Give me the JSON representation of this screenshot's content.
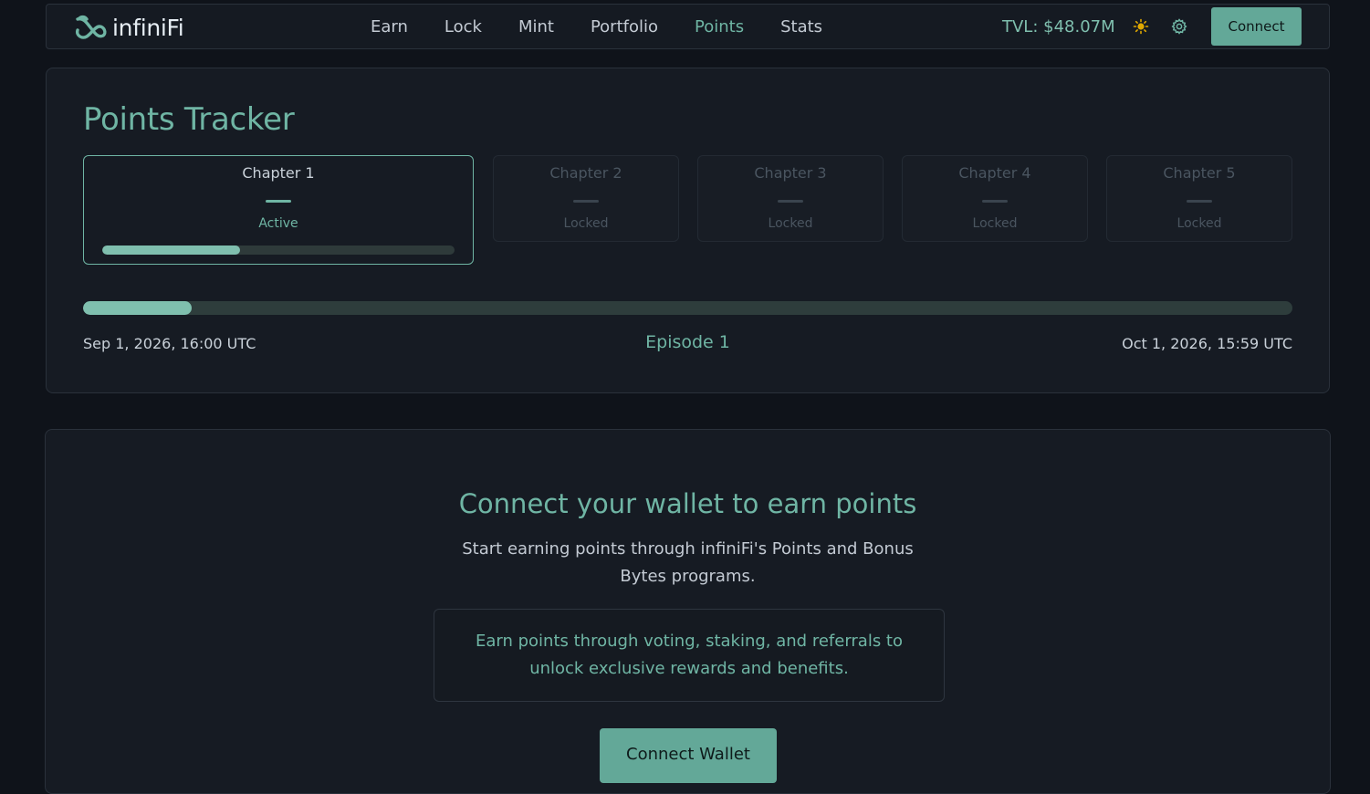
{
  "brand": {
    "name": "infiniFi",
    "accent": "#6fb5a4",
    "background": "#0f131a"
  },
  "nav": {
    "links": [
      {
        "label": "Earn"
      },
      {
        "label": "Lock"
      },
      {
        "label": "Mint"
      },
      {
        "label": "Portfolio"
      },
      {
        "label": "Points",
        "active": true
      },
      {
        "label": "Stats"
      }
    ],
    "tvl": "TVL: $48.07M",
    "theme_icon": "sun-icon",
    "settings_icon": "gear-icon",
    "connect_label": "Connect"
  },
  "tracker": {
    "title": "Points Tracker",
    "chapters": [
      {
        "name": "Chapter 1",
        "status": "Active",
        "progress": 0.39
      },
      {
        "name": "Chapter 2",
        "status": "Locked"
      },
      {
        "name": "Chapter 3",
        "status": "Locked"
      },
      {
        "name": "Chapter 4",
        "status": "Locked"
      },
      {
        "name": "Chapter 5",
        "status": "Locked"
      }
    ],
    "episode": {
      "label": "Episode 1",
      "start": "Sep 1, 2026, 16:00 UTC",
      "end": "Oct 1, 2026, 15:59 UTC",
      "progress": 0.09
    }
  },
  "connect_card": {
    "title": "Connect your wallet to earn points",
    "subtitle": "Start earning points through infiniFi's Points and Bonus Bytes programs.",
    "info": "Earn points through voting, staking, and referrals to unlock exclusive rewards and benefits.",
    "button_label": "Connect Wallet"
  }
}
